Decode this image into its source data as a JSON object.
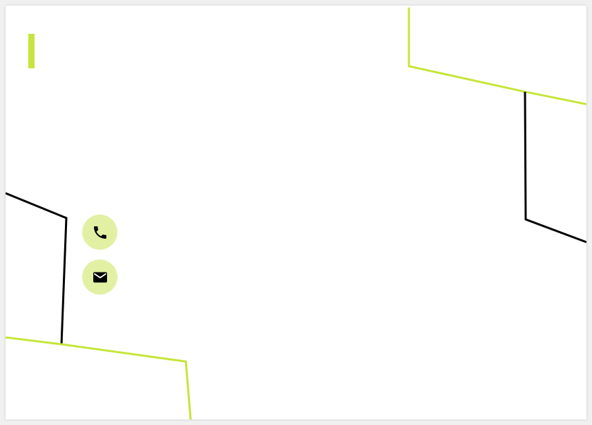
{
  "colors": {
    "accent": "#c5e53b",
    "accent_soft": "#e2f0a4",
    "ink": "#000000",
    "card": "#ffffff"
  },
  "contact": {
    "items": [
      {
        "icon": "phone-icon"
      },
      {
        "icon": "email-icon"
      }
    ]
  }
}
